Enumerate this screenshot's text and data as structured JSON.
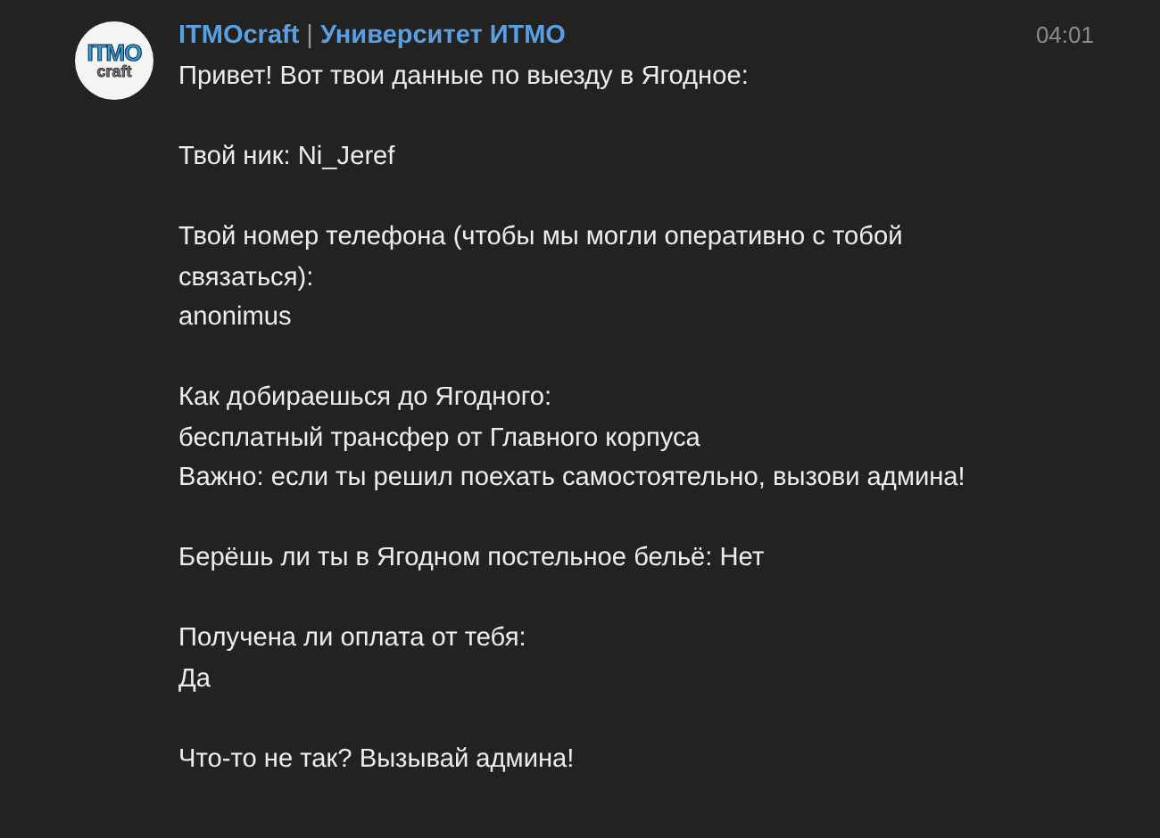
{
  "avatar": {
    "logo_lines": [
      "ITMO",
      "craft"
    ]
  },
  "sender": {
    "name": "ITMOcraft",
    "separator": "|",
    "channel": "Университет ИТМО"
  },
  "time": "04:01",
  "message": [
    [
      "Привет! Вот твои данные по выезду в Ягодное:"
    ],
    [
      "Твой ник: Ni_Jeref"
    ],
    [
      "Твой номер телефона (чтобы мы могли оперативно с тобой связаться):",
      "anonimus"
    ],
    [
      "Как добираешься до Ягодного:",
      "бесплатный трансфер от Главного корпуса",
      "Важно: если ты решил поехать самостоятельно, вызови админа!"
    ],
    [
      "Берёшь ли ты в Ягодном постельное бельё: Нет"
    ],
    [
      "Получена ли оплата от тебя:",
      "Да"
    ],
    [
      "Что-то не так? Вызывай админа!"
    ]
  ]
}
